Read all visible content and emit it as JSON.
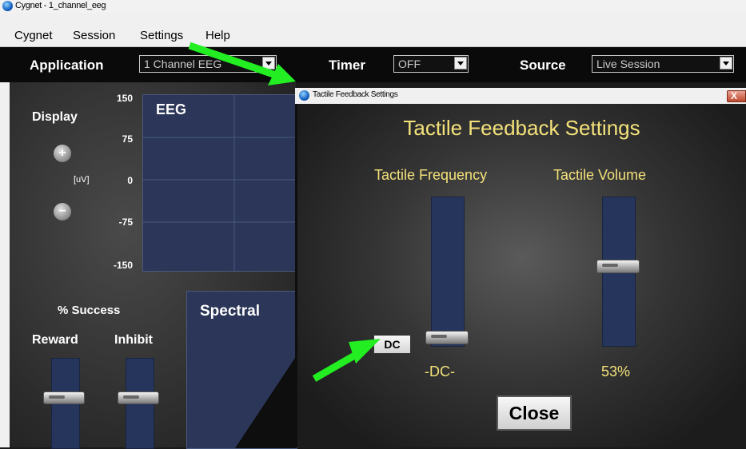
{
  "window": {
    "title": "Cygnet - 1_channel_eeg"
  },
  "menu": [
    "Cygnet",
    "Session",
    "Settings",
    "Help"
  ],
  "toolbar": {
    "application_label": "Application",
    "application_value": "1 Channel EEG",
    "timer_label": "Timer",
    "timer_value": "OFF",
    "source_label": "Source",
    "source_value": "Live Session"
  },
  "left": {
    "display_label": "Display",
    "plus": "+",
    "minus": "−",
    "unit": "[uV]",
    "yticks": [
      "150",
      "75",
      "0",
      "-75",
      "-150"
    ],
    "eeg_title": "EEG",
    "success_label": "% Success",
    "reward_label": "Reward",
    "inhibit_label": "Inhibit",
    "spectral_title": "Spectral"
  },
  "dialog": {
    "window_title": "Tactile Feedback Settings",
    "close_glyph": "X",
    "heading": "Tactile Feedback Settings",
    "freq_label": "Tactile Frequency",
    "volume_label": "Tactile Volume",
    "freq_value": "-DC-",
    "volume_value": "53%",
    "volume_level": 0.53,
    "dc_button": "DC",
    "close_button": "Close"
  },
  "colors": {
    "accent_yellow": "#f4e27a",
    "arrow_green": "#22ee22",
    "plot_blue": "#2b3658"
  }
}
